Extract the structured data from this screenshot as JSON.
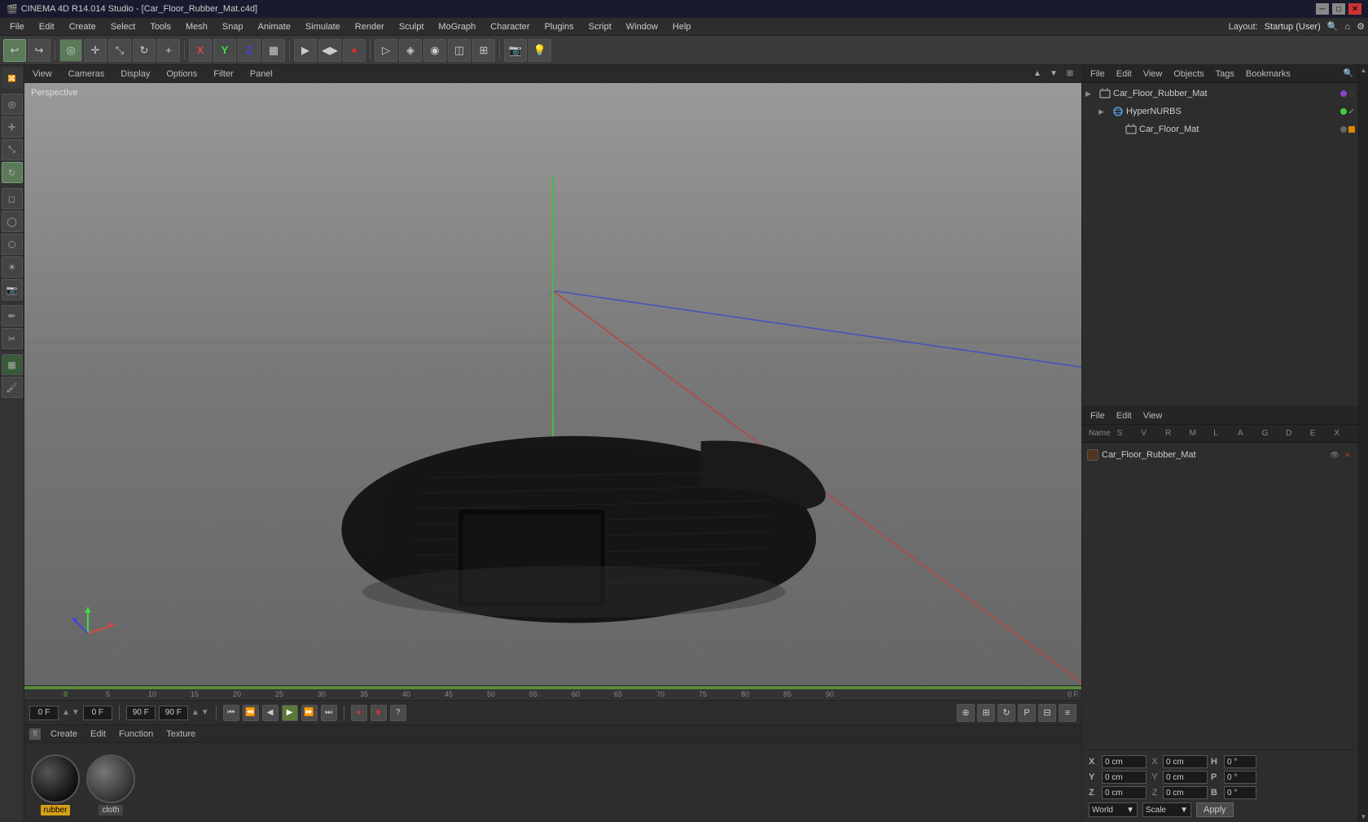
{
  "titlebar": {
    "icon": "🎬",
    "title": "CINEMA 4D R14.014 Studio - [Car_Floor_Rubber_Mat.c4d]",
    "minimize": "─",
    "maximize": "□",
    "close": "✕"
  },
  "menubar": {
    "items": [
      "File",
      "Edit",
      "Create",
      "Select",
      "Tools",
      "Mesh",
      "Snap",
      "Animate",
      "Simulate",
      "Render",
      "Sculpt",
      "MoGraph",
      "Character",
      "Plugins",
      "Script",
      "Window",
      "Help"
    ],
    "layout_label": "Layout:",
    "layout_value": "Startup (User)"
  },
  "viewport": {
    "perspective_label": "Perspective",
    "view_menus": [
      "View",
      "Cameras",
      "Display",
      "Options",
      "Filter",
      "Panel"
    ]
  },
  "timeline": {
    "markers": [
      "0",
      "5",
      "10",
      "15",
      "20",
      "25",
      "30",
      "35",
      "40",
      "45",
      "50",
      "55",
      "60",
      "65",
      "70",
      "75",
      "80",
      "85",
      "90"
    ],
    "current_frame": "0 F",
    "end_frame": "90 F"
  },
  "playback": {
    "start_frame": "0 F",
    "current_frame": "0 F",
    "end_frame": "90 F",
    "fps": "90 F"
  },
  "materials": {
    "toolbar": [
      "Create",
      "Edit",
      "Function",
      "Texture"
    ],
    "items": [
      {
        "name": "rubber",
        "type": "rubber",
        "active": true
      },
      {
        "name": "cloth",
        "type": "cloth",
        "active": false
      }
    ]
  },
  "object_manager": {
    "toolbar": [
      "File",
      "Edit",
      "View",
      "Objects",
      "Tags",
      "Bookmarks"
    ],
    "search_placeholder": "Search",
    "objects": [
      {
        "name": "Car_Floor_Rubber_Mat",
        "level": 0,
        "icon": "📦",
        "dot": "purple",
        "has_tag": true,
        "tag_name": ""
      },
      {
        "name": "HyperNURBS",
        "level": 1,
        "icon": "🔷",
        "dot": "green",
        "checkmark": true
      },
      {
        "name": "Car_Floor_Mat",
        "level": 2,
        "icon": "📦",
        "dot": "gray",
        "has_tag": true
      }
    ]
  },
  "material_editor": {
    "toolbar": [
      "File",
      "Edit",
      "View"
    ],
    "header": {
      "name": "Name",
      "cols": [
        "S",
        "V",
        "R",
        "M",
        "L",
        "A",
        "G",
        "D",
        "E",
        "X"
      ]
    },
    "materials": [
      {
        "name": "Car_Floor_Rubber_Mat",
        "swatch": "#553322"
      }
    ]
  },
  "coordinates": {
    "x_pos": "0 cm",
    "y_pos": "0 cm",
    "z_pos": "0 cm",
    "x_size": "0 cm",
    "y_size": "0 cm",
    "z_size": "0 cm",
    "h": "0 °",
    "p": "0 °",
    "b": "0 °",
    "world_label": "World",
    "scale_label": "Scale",
    "apply_label": "Apply"
  }
}
